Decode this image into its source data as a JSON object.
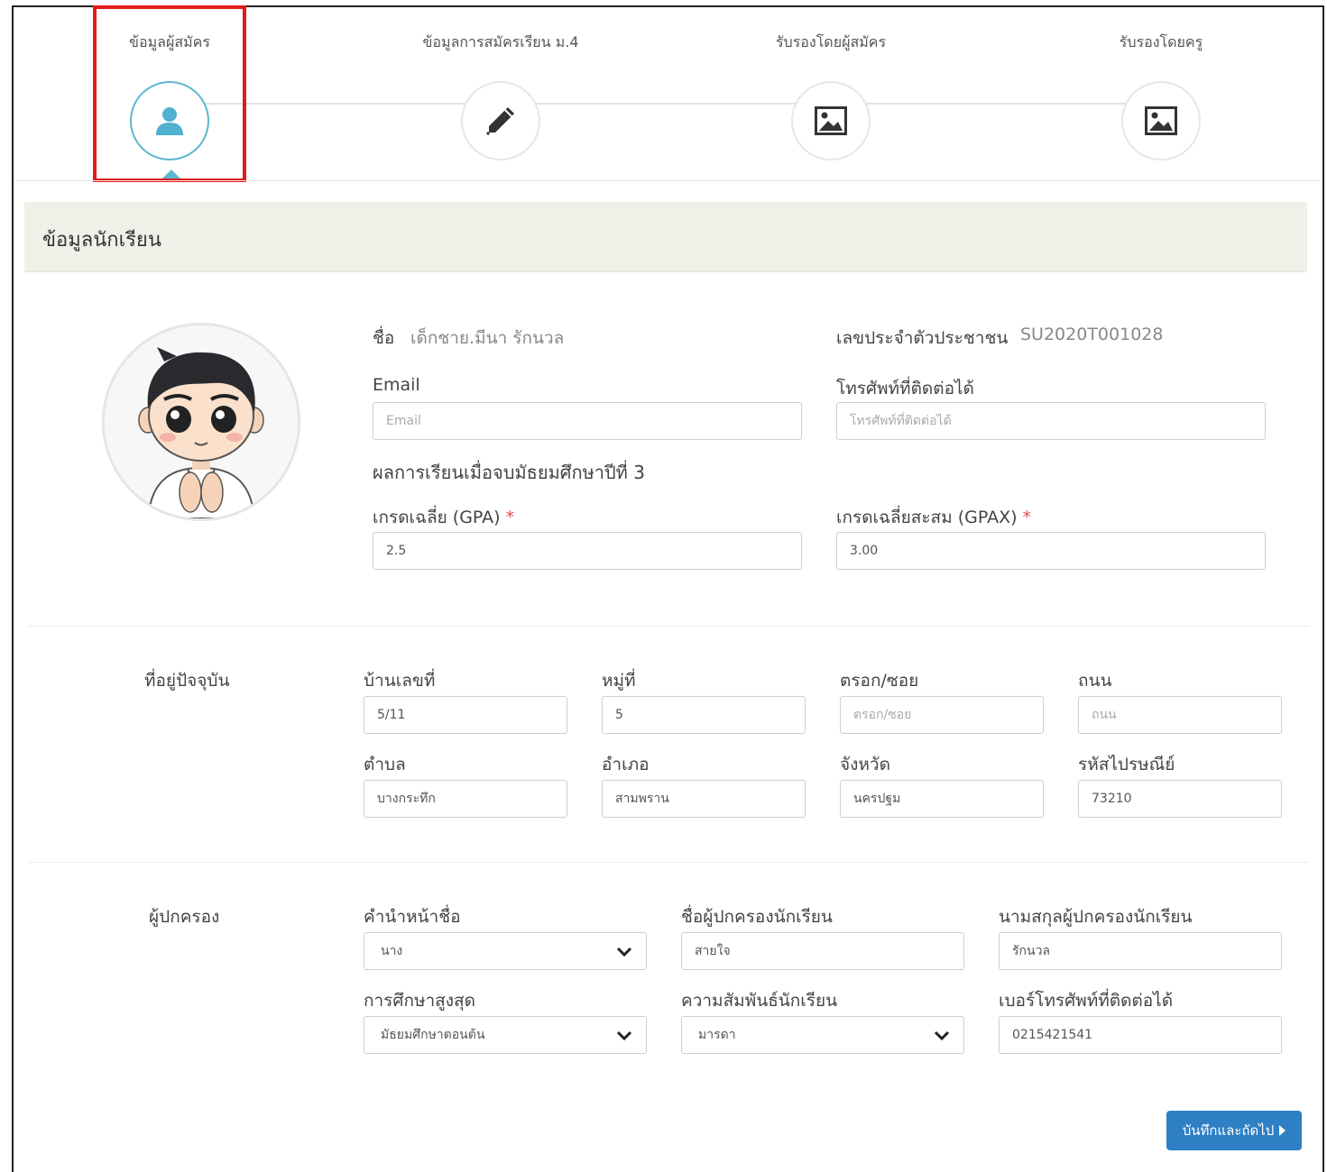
{
  "steps": [
    {
      "label": "ข้อมูลผู้สมัคร",
      "icon": "user-icon",
      "active": true
    },
    {
      "label": "ข้อมูลการสมัครเรียน ม.4",
      "icon": "pencil-icon",
      "active": false
    },
    {
      "label": "รับรองโดยผู้สมัคร",
      "icon": "image-icon",
      "active": false
    },
    {
      "label": "รับรองโดยครู",
      "icon": "image-icon",
      "active": false
    }
  ],
  "section_title": "ข้อมูลนักเรียน",
  "student": {
    "name_label": "ชื่อ",
    "name_value": "เด็กชาย.มีนา รักนวล",
    "id_label": "เลขประจำตัวประชาชน",
    "id_value": "SU2020T001028",
    "email_label": "Email",
    "email_placeholder": "Email",
    "phone_label": "โทรศัพท์ที่ติดต่อได้",
    "phone_placeholder": "โทรศัพท์ที่ติดต่อได้",
    "results_title": "ผลการเรียนเมื่อจบมัธยมศึกษาปีที่ 3",
    "gpa_label": "เกรดเฉลี่ย (GPA)",
    "gpa_value": "2.5",
    "gpax_label": "เกรดเฉลี่ยสะสม (GPAX)",
    "gpax_value": "3.00",
    "required_mark": "*"
  },
  "address": {
    "section_label": "ที่อยู่ปัจจุบัน",
    "house_no_label": "บ้านเลขที่",
    "house_no_value": "5/11",
    "moo_label": "หมู่ที่",
    "moo_value": "5",
    "soi_label": "ตรอก/ซอย",
    "soi_placeholder": "ตรอก/ซอย",
    "road_label": "ถนน",
    "road_placeholder": "ถนน",
    "subdistrict_label": "ตำบล",
    "subdistrict_value": "บางกระทึก",
    "district_label": "อำเภอ",
    "district_value": "สามพราน",
    "province_label": "จังหวัด",
    "province_value": "นครปฐม",
    "postcode_label": "รหัสไปรษณีย์",
    "postcode_value": "73210"
  },
  "guardian": {
    "section_label": "ผู้ปกครอง",
    "prefix_label": "คำนำหน้าชื่อ",
    "prefix_value": "นาง",
    "firstname_label": "ชื่อผู้ปกครองนักเรียน",
    "firstname_value": "สายใจ",
    "lastname_label": "นามสกุลผู้ปกครองนักเรียน",
    "lastname_value": "รักนวล",
    "education_label": "การศึกษาสูงสุด",
    "education_value": "มัธยมศึกษาตอนต้น",
    "relation_label": "ความสัมพันธ์นักเรียน",
    "relation_value": "มารดา",
    "phone_label": "เบอร์โทรศัพท์ที่ติดต่อได้",
    "phone_value": "0215421541"
  },
  "actions": {
    "next_label": "บันทึกและถัดไป"
  },
  "colors": {
    "accent": "#5bb7d2",
    "primary_button": "#2f7fc4",
    "highlight": "#e21b1b",
    "section_bg": "#eef1e7"
  }
}
